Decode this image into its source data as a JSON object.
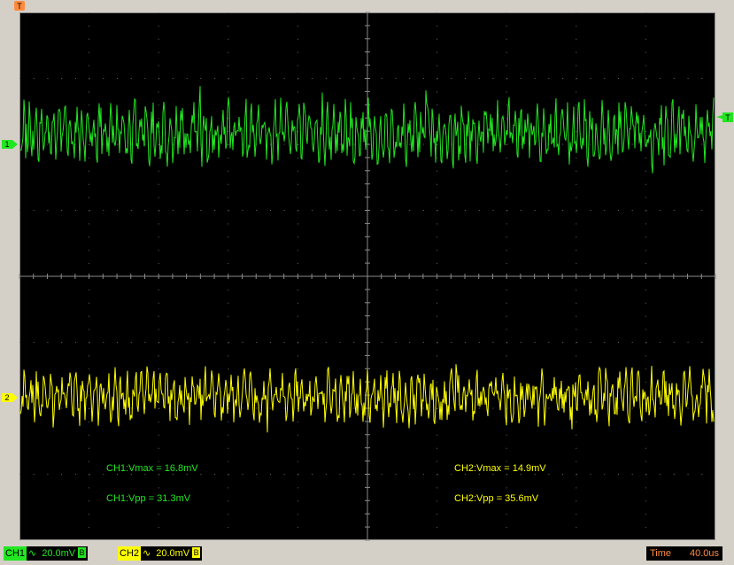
{
  "colors": {
    "ch1": "#22e622",
    "ch2": "#ffff00",
    "marker": "#ff8a3d",
    "grid": "#8a8a8a",
    "screen": "#000000",
    "frame": "#d4d0c8"
  },
  "markers": {
    "trigger_top": "T",
    "trigger_right": "T",
    "ch1": "1",
    "ch2": "2"
  },
  "measurements": {
    "ch1_vmax": "CH1:Vmax = 16.8mV",
    "ch1_vpp": "CH1:Vpp = 31.3mV",
    "ch2_vmax": "CH2:Vmax = 14.9mV",
    "ch2_vpp": "CH2:Vpp = 35.6mV"
  },
  "status": {
    "ch1": {
      "label": "CH1",
      "coupling_icon": "ac-coupling-icon",
      "coupling_glyph": "∿",
      "scale": "20.0mV",
      "bw": "B"
    },
    "ch2": {
      "label": "CH2",
      "coupling_icon": "ac-coupling-icon",
      "coupling_glyph": "∿",
      "scale": "20.0mV",
      "bw": "B"
    },
    "time_label": "Time",
    "time_value": "40.0us"
  }
}
